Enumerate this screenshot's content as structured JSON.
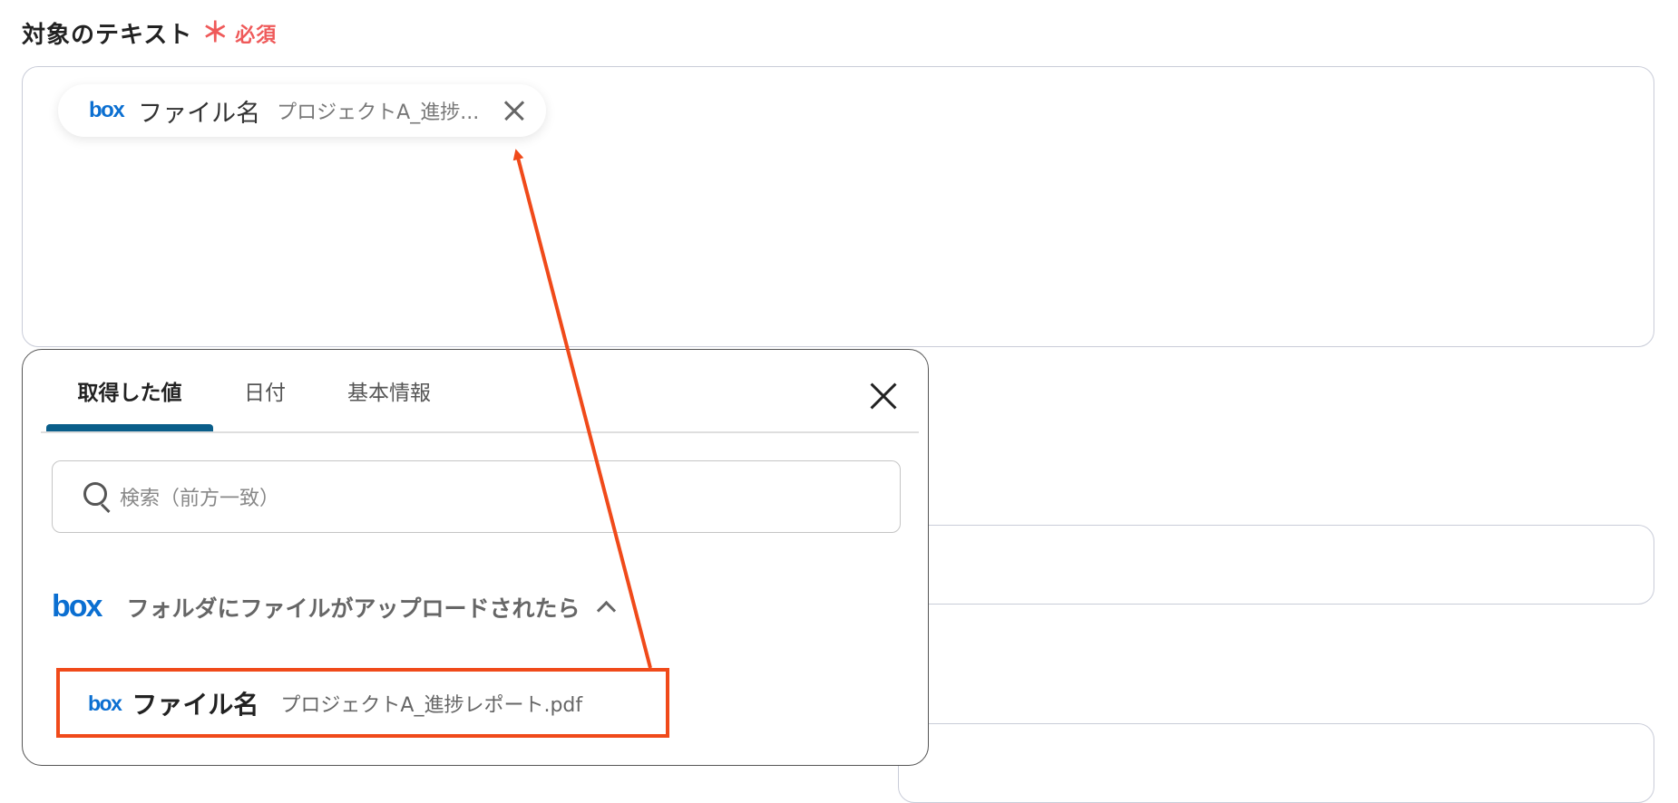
{
  "field": {
    "label": "対象のテキスト",
    "required_star": "＊",
    "required_text": "必須"
  },
  "chip": {
    "logo": "box",
    "name": "ファイル名",
    "value": "プロジェクトA_進捗..."
  },
  "panel": {
    "tabs": [
      {
        "label": "取得した値",
        "active": true
      },
      {
        "label": "日付",
        "active": false
      },
      {
        "label": "基本情報",
        "active": false
      }
    ],
    "search_placeholder": "検索（前方一致）",
    "group": {
      "logo": "box",
      "title": "フォルダにファイルがアップロードされたら"
    },
    "item": {
      "logo": "box",
      "name": "ファイル名",
      "value": "プロジェクトA_進捗レポート.pdf"
    }
  },
  "annotation": {
    "highlight_color": "#f04a1a"
  },
  "colors": {
    "accent": "#0a5e8a",
    "box_brand": "#0b6fd1",
    "required": "#ef5a5a"
  }
}
